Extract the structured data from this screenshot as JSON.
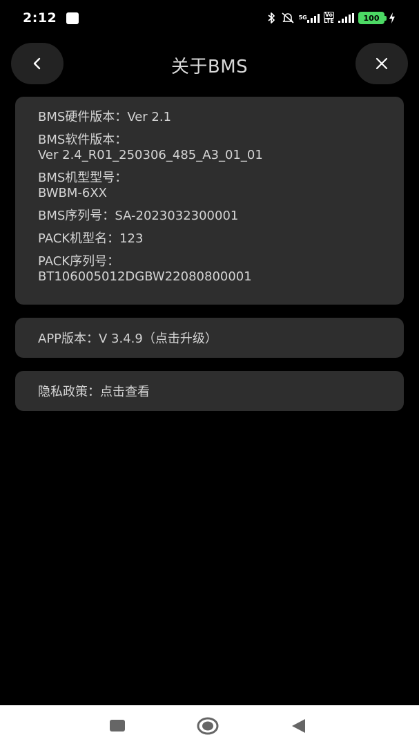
{
  "status_bar": {
    "time": "2:12",
    "net_5g": "5G",
    "volte": "Vo",
    "lte": "LTE",
    "battery": "100"
  },
  "header": {
    "title": "关于BMS"
  },
  "info": {
    "hw_label": "BMS硬件版本：",
    "hw_value": "Ver 2.1",
    "sw_label": "BMS软件版本：",
    "sw_value": "Ver 2.4_R01_250306_485_A3_01_01",
    "model_label": "BMS机型型号：",
    "model_value": "BWBM-6XX",
    "serial_label": "BMS序列号：",
    "serial_value": "SA-2023032300001",
    "pack_model_label": "PACK机型名：",
    "pack_model_value": "123",
    "pack_serial_label": "PACK序列号：",
    "pack_serial_value": "BT106005012DGBW22080800001"
  },
  "app": {
    "text": "APP版本：V 3.4.9（点击升级）"
  },
  "privacy": {
    "text": "隐私政策：点击查看"
  },
  "colors": {
    "background": "#000000",
    "card": "#2e2e2e",
    "battery": "#4cd964"
  }
}
